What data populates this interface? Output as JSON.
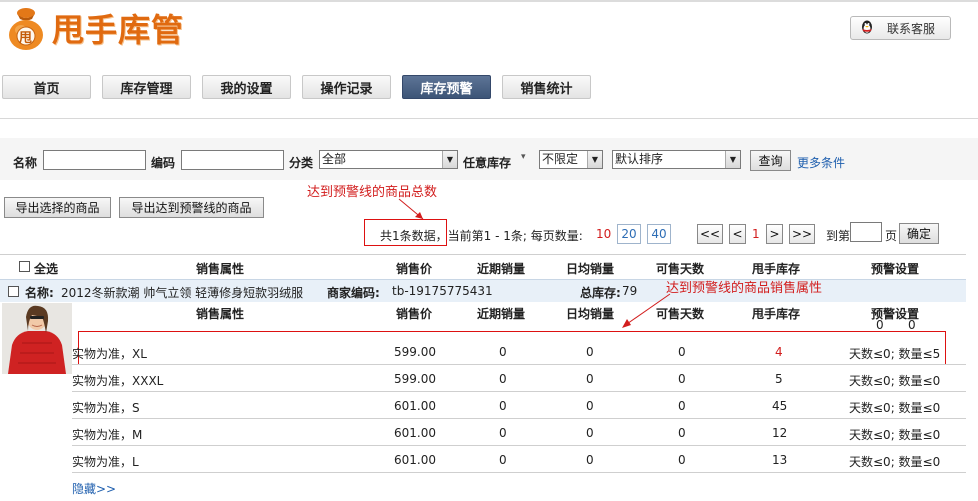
{
  "header": {
    "logo_text": "甩手库管",
    "logo_glyph": "甩",
    "contact_label": "联系客服"
  },
  "nav": {
    "tabs": [
      {
        "label": "首页"
      },
      {
        "label": "库存管理"
      },
      {
        "label": "我的设置"
      },
      {
        "label": "操作记录"
      },
      {
        "label": "库存预警",
        "active": true
      },
      {
        "label": "销售统计"
      }
    ]
  },
  "filter": {
    "name_label": "名称",
    "name_value": "",
    "code_label": "编码",
    "code_value": "",
    "category_label": "分类",
    "category_value": "全部",
    "stock_label": "任意库存",
    "stock_value": "不限定",
    "sort_value": "默认排序",
    "query_label": "查询",
    "more_label": "更多条件"
  },
  "actions": {
    "export_selected": "导出选择的商品",
    "export_warning": "导出达到预警线的商品"
  },
  "annotations": {
    "total_note": "达到预警线的商品总数",
    "attr_note": "达到预警线的商品销售属性"
  },
  "pager": {
    "summary": "共1条数据，当前第1 - 1条;  每页数量:",
    "sizes": [
      "10",
      "20",
      "40"
    ],
    "first": "<<",
    "prev": "<",
    "current": "1",
    "next": ">",
    "last": ">>",
    "goto_label": "到第",
    "goto_value": "",
    "page_suffix": "页",
    "confirm": "确定"
  },
  "table": {
    "select_all": "全选",
    "headers": [
      "销售属性",
      "销售价",
      "近期销量",
      "日均销量",
      "可售天数",
      "甩手库存",
      "预警设置"
    ],
    "product": {
      "name_label": "名称:",
      "name": "2012冬新款潮 帅气立领 轻薄修身短款羽绒服",
      "code_label": "商家编码:",
      "code": "tb-19175775431",
      "stock_label": "总库存:",
      "stock": "79"
    },
    "sub_headers": [
      "销售属性",
      "销售价",
      "近期销量",
      "日均销量",
      "可售天数",
      "甩手库存",
      "预警设置"
    ],
    "warn_defaults": [
      "0",
      "0"
    ],
    "rows": [
      {
        "attr": "实物为准，XL",
        "price": "599.00",
        "recent": "0",
        "daily": "0",
        "days": "0",
        "stock": "4",
        "warn": "天数≤0; 数量≤5",
        "highlight": true
      },
      {
        "attr": "实物为准，XXXL",
        "price": "599.00",
        "recent": "0",
        "daily": "0",
        "days": "0",
        "stock": "5",
        "warn": "天数≤0; 数量≤0"
      },
      {
        "attr": "实物为准，S",
        "price": "601.00",
        "recent": "0",
        "daily": "0",
        "days": "0",
        "stock": "45",
        "warn": "天数≤0; 数量≤0"
      },
      {
        "attr": "实物为准，M",
        "price": "601.00",
        "recent": "0",
        "daily": "0",
        "days": "0",
        "stock": "12",
        "warn": "天数≤0; 数量≤0"
      },
      {
        "attr": "实物为准，L",
        "price": "601.00",
        "recent": "0",
        "daily": "0",
        "days": "0",
        "stock": "13",
        "warn": "天数≤0; 数量≤0"
      }
    ],
    "hide_label": "隐藏>>"
  },
  "colors": {
    "accent": "#e06a10",
    "active_tab": "#4a6285",
    "warning_red": "#d21d1d",
    "link_blue": "#1f5fae"
  }
}
